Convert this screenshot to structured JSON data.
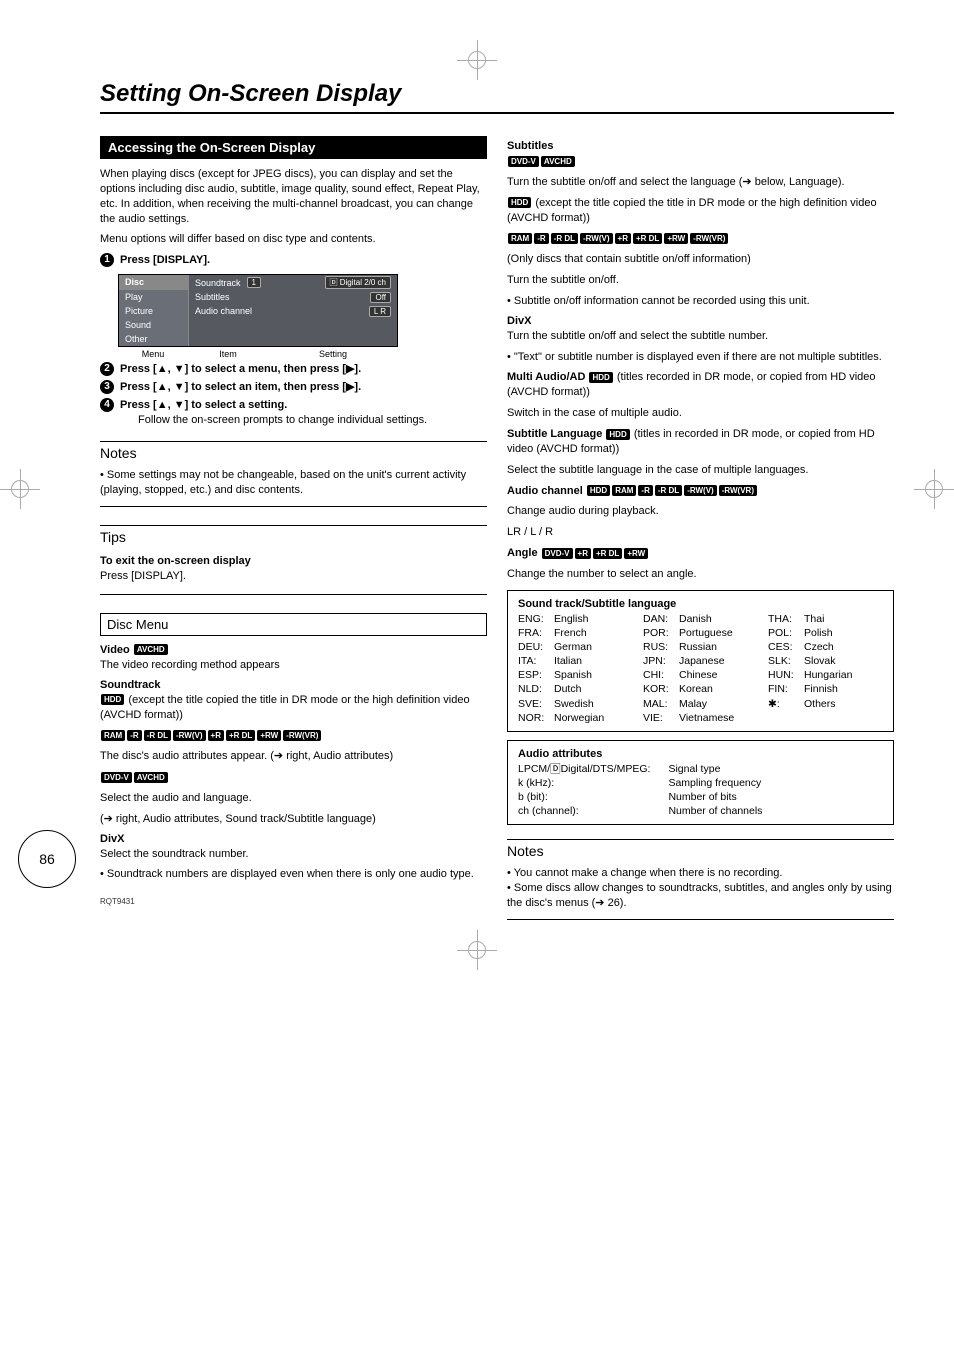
{
  "page_number": "86",
  "footer_code": "RQT9431",
  "title": "Setting On-Screen Display",
  "left": {
    "section_header": "Accessing the On-Screen Display",
    "intro1": "When playing discs (except for JPEG discs), you can display and set the options including disc audio, subtitle, image quality, sound effect, Repeat Play, etc. In addition, when receiving the multi-channel broadcast, you can change the audio settings.",
    "intro2": "Menu options will differ based on disc type and contents.",
    "step1": "Press [DISPLAY].",
    "osd": {
      "left_items": [
        "Disc",
        "Play",
        "Picture",
        "Sound",
        "Other"
      ],
      "row1_label": "Soundtrack",
      "row1_mid": "1",
      "row1_right": "Digital   2/0 ch",
      "row2_label": "Subtitles",
      "row2_right": "Off",
      "row3_label": "Audio channel",
      "row3_right": "L R",
      "lbl_menu": "Menu",
      "lbl_item": "Item",
      "lbl_setting": "Setting"
    },
    "step2": "Press [▲, ▼] to select a menu, then press [▶].",
    "step3": "Press [▲, ▼] to select an item, then press [▶].",
    "step4": "Press [▲, ▼] to select a setting.",
    "step4_follow": "Follow the on-screen prompts to change individual settings.",
    "notes_hdr": "Notes",
    "notes_body": "• Some settings may not be changeable, based on the unit's current activity (playing, stopped, etc.) and disc contents.",
    "tips_hdr": "Tips",
    "tips_line1": "To exit the on-screen display",
    "tips_line2": "Press [DISPLAY].",
    "disc_menu_hdr": "Disc Menu",
    "video_hdr": "Video",
    "video_tag": "AVCHD",
    "video_line": "The video recording method appears",
    "sound_hdr": "Soundtrack",
    "sound_hdd": "HDD",
    "sound_hdd_txt": "(except the title copied the title in DR mode or the high definition video (AVCHD format))",
    "sound_tags": [
      "RAM",
      "-R",
      "-R DL",
      "-RW(V)",
      "+R",
      "+R DL",
      "+RW",
      "-RW(VR)"
    ],
    "sound_line2": "The disc's audio attributes appear. (➔ right, Audio attributes)",
    "sound_tags2": [
      "DVD-V",
      "AVCHD"
    ],
    "sound_line3": "Select the audio and language.",
    "sound_line4": "(➔ right, Audio attributes, Sound track/Subtitle language)",
    "divx_hdr": "DivX",
    "divx_line1": "Select the soundtrack number.",
    "divx_line2": "• Soundtrack numbers are displayed even when there is only one audio type."
  },
  "right": {
    "sub_hdr": "Subtitles",
    "sub_tags1": [
      "DVD-V",
      "AVCHD"
    ],
    "sub_line1": "Turn the subtitle on/off and select the language (➔ below, Language).",
    "sub_hdd": "HDD",
    "sub_hdd_txt": "(except the title copied the title in DR mode or the high definition video (AVCHD format))",
    "sub_tags2": [
      "RAM",
      "-R",
      "-R DL",
      "-RW(V)",
      "+R",
      "+R DL",
      "+RW",
      "-RW(VR)"
    ],
    "sub_line2": "(Only discs that contain subtitle on/off information)",
    "sub_line3": "Turn the subtitle on/off.",
    "sub_line4": "• Subtitle on/off information cannot be recorded using this unit.",
    "divx_hdr": "DivX",
    "divx_line1": "Turn the subtitle on/off and select the subtitle number.",
    "divx_line2": "• \"Text\" or subtitle number is displayed even if there are not multiple subtitles.",
    "multi_hdr": "Multi Audio/AD",
    "multi_tag": "HDD",
    "multi_txt1": "(titles recorded in DR mode, or copied from HD video (AVCHD format))",
    "multi_txt2": "Switch in the case of multiple audio.",
    "sublang_hdr": "Subtitle Language",
    "sublang_tag": "HDD",
    "sublang_txt1": "(titles in recorded in DR mode, or copied from HD video (AVCHD format))",
    "sublang_txt2": "Select the subtitle language in the case of multiple languages.",
    "audch_hdr": "Audio channel",
    "audch_tags": [
      "HDD",
      "RAM",
      "-R",
      "-R DL",
      "-RW(V)",
      "-RW(VR)"
    ],
    "audch_l1": "Change audio during playback.",
    "audch_l2": "LR / L / R",
    "angle_hdr": "Angle",
    "angle_tags": [
      "DVD-V",
      "+R",
      "+R DL",
      "+RW"
    ],
    "angle_l1": "Change the number to select an angle.",
    "langbox_hdr": "Sound track/Subtitle language",
    "langs": [
      [
        [
          "ENG:",
          "English"
        ],
        [
          "FRA:",
          "French"
        ],
        [
          "DEU:",
          "German"
        ],
        [
          "ITA:",
          "Italian"
        ],
        [
          "ESP:",
          "Spanish"
        ],
        [
          "NLD:",
          "Dutch"
        ],
        [
          "SVE:",
          "Swedish"
        ],
        [
          "NOR:",
          "Norwegian"
        ]
      ],
      [
        [
          "DAN:",
          "Danish"
        ],
        [
          "POR:",
          "Portuguese"
        ],
        [
          "RUS:",
          "Russian"
        ],
        [
          "JPN:",
          "Japanese"
        ],
        [
          "CHI:",
          "Chinese"
        ],
        [
          "KOR:",
          "Korean"
        ],
        [
          "MAL:",
          "Malay"
        ],
        [
          "VIE:",
          "Vietnamese"
        ]
      ],
      [
        [
          "THA:",
          "Thai"
        ],
        [
          "POL:",
          "Polish"
        ],
        [
          "CES:",
          "Czech"
        ],
        [
          "SLK:",
          "Slovak"
        ],
        [
          "HUN:",
          "Hungarian"
        ],
        [
          "FIN:",
          "Finnish"
        ],
        [
          "✱:",
          "Others"
        ]
      ]
    ],
    "audiobox_hdr": "Audio attributes",
    "audio_left": [
      "LPCM/🄳Digital/DTS/MPEG:",
      "k (kHz):",
      "b (bit):",
      "ch (channel):"
    ],
    "audio_right": [
      "Signal type",
      "Sampling frequency",
      "Number of bits",
      "Number of channels"
    ],
    "notes_hdr": "Notes",
    "notes_l1": "• You cannot make a change when there is no recording.",
    "notes_l2": "• Some discs allow changes to soundtracks, subtitles, and angles only by using the disc's menus (➔ 26)."
  }
}
